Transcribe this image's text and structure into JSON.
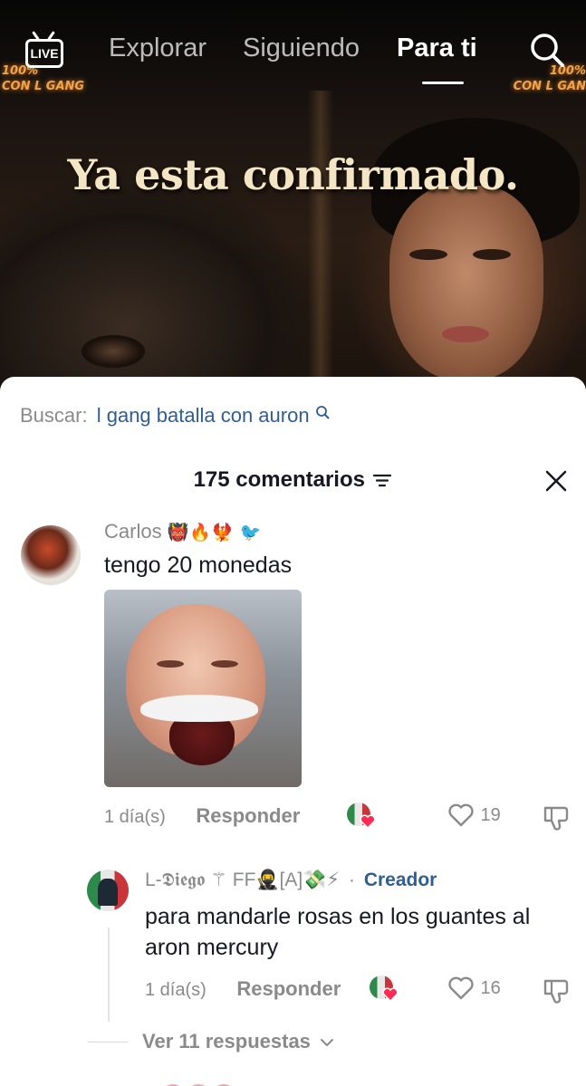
{
  "nav": {
    "live_label": "LIVE",
    "tabs": [
      {
        "label": "Explorar",
        "active": false
      },
      {
        "label": "Siguiendo",
        "active": false
      },
      {
        "label": "Para ti",
        "active": true
      }
    ],
    "search_icon": "search-icon"
  },
  "video": {
    "overlay_title": "Ya esta confirmado.",
    "neon_left_line1": "100%",
    "neon_left_line2": "CON L GANG",
    "neon_right_line1": "100%",
    "neon_right_line2": "CON L GAN"
  },
  "comments_sheet": {
    "search_label": "Buscar:",
    "search_query": "l gang batalla con auron",
    "count_label": "175 comentarios",
    "close_icon": "close-icon",
    "sort_icon": "sort-icon",
    "comments": [
      {
        "username": "Carlos",
        "badges": "👹🔥🐦‍🔥 🐦",
        "text": "tengo 20 monedas",
        "has_image": true,
        "time": "1 día(s)",
        "reply_label": "Responder",
        "liked_by_creator": true,
        "likes": "19"
      }
    ],
    "reply": {
      "username": "L-𝕯𝖎𝖊𝖌𝖔 ⚚ FF🥷[A]💸⚡",
      "separator": "·",
      "creator_label": "Creador",
      "text": "para mandarle rosas en los guantes al aron mercury",
      "time": "1 día(s)",
      "reply_label": "Responder",
      "liked_by_creator": true,
      "likes": "16"
    },
    "view_replies_label": "Ver 11 respuestas"
  },
  "colors": {
    "link_blue": "#2f5e93",
    "muted_gray": "#8a8a8a",
    "text_dark": "#161823",
    "heart_red": "#fe2c55"
  }
}
